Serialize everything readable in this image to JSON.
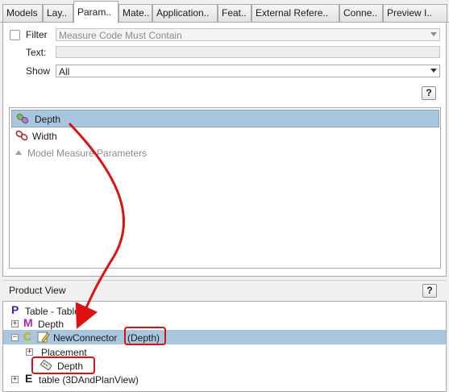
{
  "tabs": [
    {
      "label": "Models"
    },
    {
      "label": "Lay.."
    },
    {
      "label": "Param.."
    },
    {
      "label": "Mate.."
    },
    {
      "label": "Application.."
    },
    {
      "label": "Feat.."
    },
    {
      "label": "External Refere.."
    },
    {
      "label": "Conne.."
    },
    {
      "label": "Preview I.."
    }
  ],
  "active_tab": "Param..",
  "filter": {
    "checkbox_label": "Filter",
    "checked": false,
    "combo_value": "Measure Code Must Contain",
    "text_label": "Text:",
    "text_value": "",
    "show_label": "Show",
    "show_value": "All",
    "help_label": "?"
  },
  "parameters": {
    "items": [
      {
        "label": "Depth",
        "selected": true,
        "icon": "linked-parameter-icon"
      },
      {
        "label": "Width",
        "selected": false,
        "icon": "parameter-chain-icon"
      },
      {
        "label": "Model Measure Parameters",
        "selected": false,
        "icon": "collapse-up-icon"
      }
    ]
  },
  "product_view": {
    "title": "Product View",
    "help_label": "?",
    "nodes": [
      {
        "letter": "P",
        "label": "Table - Table"
      },
      {
        "letter": "M",
        "label": "Depth"
      },
      {
        "letter": "C",
        "label": "NewConnector",
        "suffix": "(Depth)"
      },
      {
        "label": "Placement"
      },
      {
        "label": "Depth"
      },
      {
        "letter": "E",
        "label": "table (3DAndPlanView)"
      }
    ]
  },
  "colors": {
    "selection": "#a9c6df",
    "annotation_red": "#e01010",
    "P_letter": "#2828c8",
    "M_letter": "#b422b4",
    "C_letter": "#c8b400",
    "E_letter": "#1b1b1b"
  }
}
